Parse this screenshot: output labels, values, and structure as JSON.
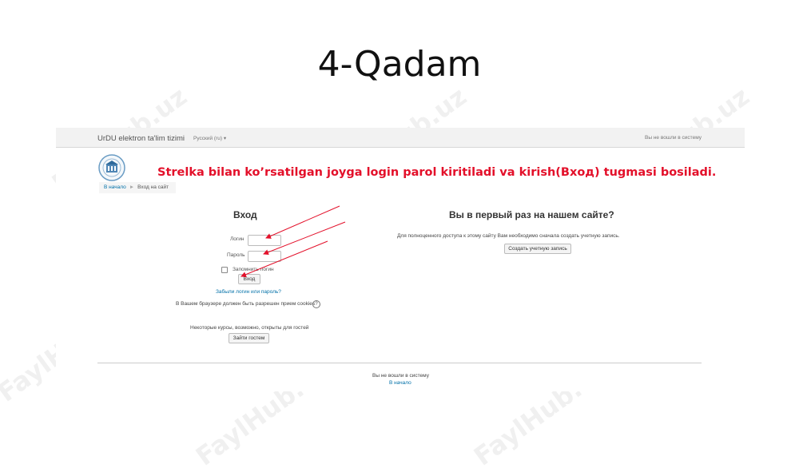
{
  "slide": {
    "title": "4-Qadam"
  },
  "watermark": "FaylHub.uz",
  "annotation": "Strelka bilan ko’rsatilgan joyga login parol kiritiladi va kirish(Вход) tugmasi bosiladi.",
  "navbar": {
    "brand": "UrDU elektron ta'lim tizimi",
    "language": "Русский (ru) ▾",
    "login_status": "Вы не вошли в систему"
  },
  "breadcrumb": {
    "home": "В начало",
    "separator": "►",
    "current": "Вход на сайт"
  },
  "login": {
    "heading": "Вход",
    "username_label": "Логин",
    "password_label": "Пароль",
    "remember_label": "Запомнить логин",
    "submit_label": "Вход",
    "forgot_link": "Забыли логин или пароль?",
    "cookies_note": "В Вашем браузере должен быть разрешен прием cookies",
    "guest_note": "Некоторые курсы, возможно, открыты для гостей",
    "guest_button": "Зайти гостем"
  },
  "signup": {
    "heading": "Вы в первый раз на нашем сайте?",
    "description": "Для полноценного доступа к этому сайту Вам необходимо сначала создать учетную запись.",
    "button": "Создать учетную запись"
  },
  "footer": {
    "status": "Вы не вошли в систему",
    "home_link": "В начало"
  },
  "colors": {
    "annotation": "#e3102a",
    "link": "#0070a8",
    "arrow": "#e3102a"
  }
}
